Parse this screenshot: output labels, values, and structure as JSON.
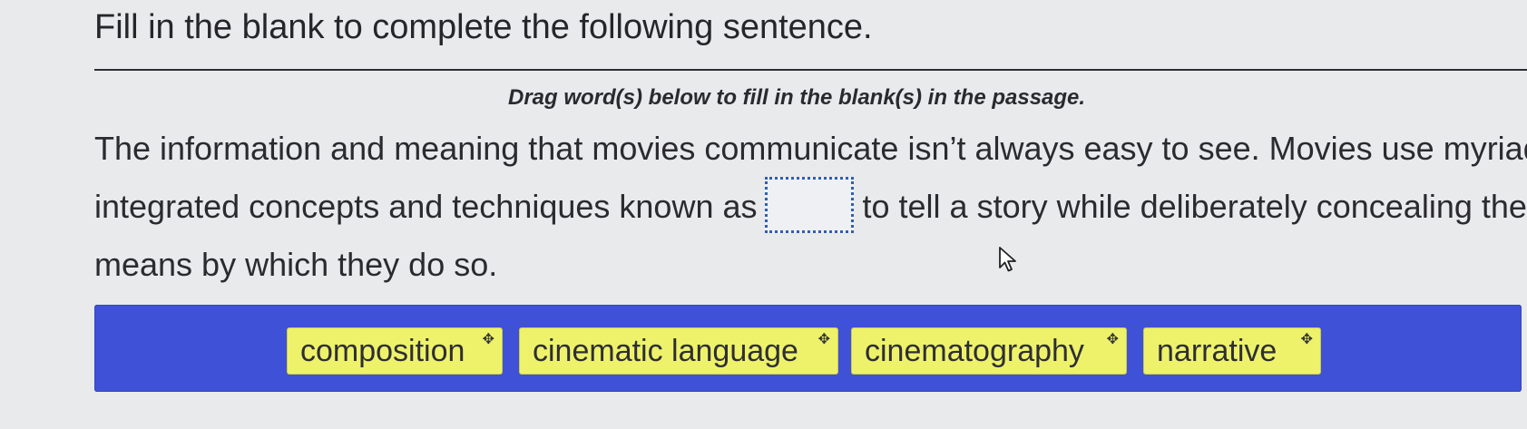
{
  "question": {
    "title": "Fill in the blank to complete the following sentence.",
    "instruction": "Drag word(s) below to fill in the blank(s) in the passage."
  },
  "passage": {
    "line1": "The information and meaning that movies communicate isn’t always easy to see. Movies use myriad",
    "line2_before": "integrated concepts and techniques known as",
    "line2_after": "to tell a story while deliberately concealing the",
    "line3": "means by which they do so.",
    "blank_value": ""
  },
  "word_bank": {
    "items": [
      {
        "label": "composition",
        "icon": "move-icon"
      },
      {
        "label": "cinematic language",
        "icon": "move-icon"
      },
      {
        "label": "cinematography",
        "icon": "move-icon"
      },
      {
        "label": "narrative",
        "icon": "move-icon"
      }
    ]
  },
  "colors": {
    "word_bank_background": "#3f51d6",
    "chip_background": "#eef26b",
    "blank_border": "#2f5fb0",
    "page_background": "#e9eaec"
  },
  "icons": {
    "cursor": "mouse-pointer-icon",
    "drag_handle": "move-icon"
  }
}
